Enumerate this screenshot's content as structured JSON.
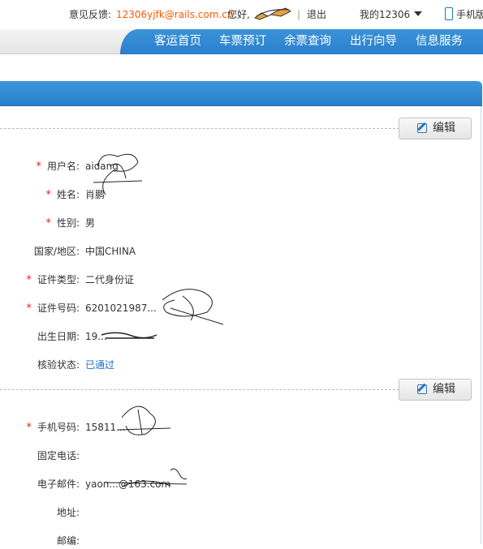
{
  "topbar": {
    "feedback_label": "意见反馈:",
    "feedback_email": "12306yjfk@rails.com.cn",
    "greeting": "您好,",
    "separator": "|",
    "logout": "退出",
    "my12306": "我的12306",
    "mobile": "手机版",
    "icons": {
      "user_scribble": "redacted-name",
      "caret": "chevron-down-icon",
      "phone": "phone-icon"
    }
  },
  "nav": {
    "items": [
      {
        "label": "客运首页"
      },
      {
        "label": "车票预订"
      },
      {
        "label": "余票查询"
      },
      {
        "label": "出行向导"
      },
      {
        "label": "信息服务"
      }
    ]
  },
  "profile": {
    "edit_label": "编辑",
    "basic": [
      {
        "label": "用户名:",
        "required": true,
        "value": "aidang"
      },
      {
        "label": "姓名:",
        "required": true,
        "value": "肖鹏"
      },
      {
        "label": "性别:",
        "required": true,
        "value": "男"
      },
      {
        "label": "国家/地区:",
        "required": false,
        "value": "中国CHINA"
      },
      {
        "label": "证件类型:",
        "required": true,
        "value": "二代身份证"
      },
      {
        "label": "证件号码:",
        "required": true,
        "value": "6201021987..."
      },
      {
        "label": "出生日期:",
        "required": false,
        "value": "19..."
      },
      {
        "label": "核验状态:",
        "required": false,
        "value": "已通过"
      }
    ],
    "contact": [
      {
        "label": "手机号码:",
        "required": true,
        "value": "15811..."
      },
      {
        "label": "固定电话:",
        "required": false,
        "value": ""
      },
      {
        "label": "电子邮件:",
        "required": false,
        "value": "yaon...@163.com"
      },
      {
        "label": "地址:",
        "required": false,
        "value": ""
      },
      {
        "label": "邮编:",
        "required": false,
        "value": ""
      }
    ],
    "required_mark": "*"
  },
  "colors": {
    "accent": "#2b7fcc",
    "email": "#ff5a00",
    "required": "#e02020",
    "link": "#1a6fc8"
  }
}
